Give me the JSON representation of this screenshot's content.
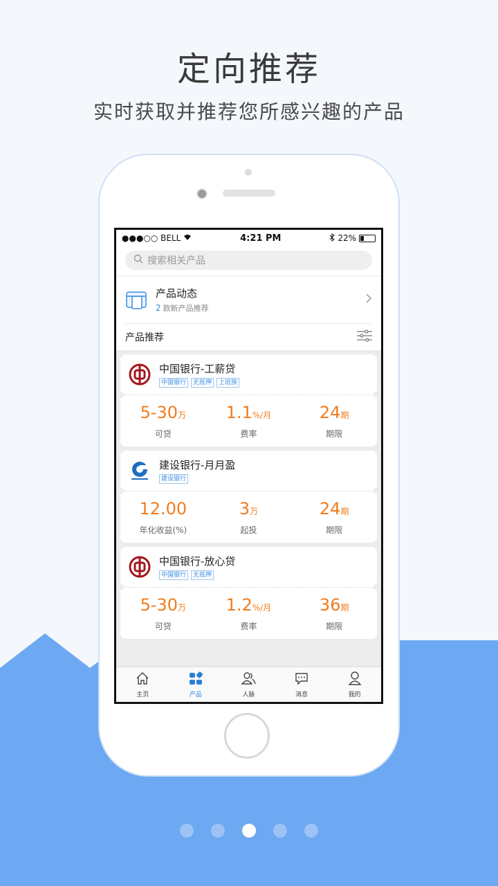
{
  "hero": {
    "title": "定向推荐",
    "subtitle": "实时获取并推荐您所感兴趣的产品"
  },
  "status": {
    "carrier": "●●●○○ BELL",
    "time": "4:21 PM",
    "battery": "22%"
  },
  "search": {
    "placeholder": "搜索相关产品"
  },
  "news": {
    "title": "产品动态",
    "count": "2",
    "desc": "款新产品推荐"
  },
  "recommend": {
    "title": "产品推荐"
  },
  "cards": [
    {
      "name": "中国银行-工薪贷",
      "tags": [
        "中国银行",
        "无抵押",
        "上班族"
      ],
      "stats": [
        {
          "value": "5-30",
          "unit": "万",
          "label": "可贷"
        },
        {
          "value": "1.1",
          "unit": "%/月",
          "label": "费率"
        },
        {
          "value": "24",
          "unit": "期",
          "label": "期限"
        }
      ]
    },
    {
      "name": "建设银行-月月盈",
      "tags": [
        "建设银行"
      ],
      "stats": [
        {
          "value": "12.00",
          "unit": "",
          "label": "年化收益(%)"
        },
        {
          "value": "3",
          "unit": "万",
          "label": "起投"
        },
        {
          "value": "24",
          "unit": "期",
          "label": "期限"
        }
      ]
    },
    {
      "name": "中国银行-放心贷",
      "tags": [
        "中国银行",
        "无抵押"
      ],
      "stats": [
        {
          "value": "5-30",
          "unit": "万",
          "label": "可贷"
        },
        {
          "value": "1.2",
          "unit": "%/月",
          "label": "费率"
        },
        {
          "value": "36",
          "unit": "期",
          "label": "期限"
        }
      ]
    }
  ],
  "tabs": [
    {
      "label": "主页",
      "icon": "home-icon"
    },
    {
      "label": "产品",
      "icon": "grid-icon"
    },
    {
      "label": "人脉",
      "icon": "contacts-icon"
    },
    {
      "label": "消息",
      "icon": "message-icon"
    },
    {
      "label": "我的",
      "icon": "profile-icon"
    }
  ],
  "pager": {
    "count": 5,
    "active": 2
  },
  "colors": {
    "accent": "#2b7fd6",
    "orange": "#f07c1e",
    "mountain": "#6da8f2"
  }
}
